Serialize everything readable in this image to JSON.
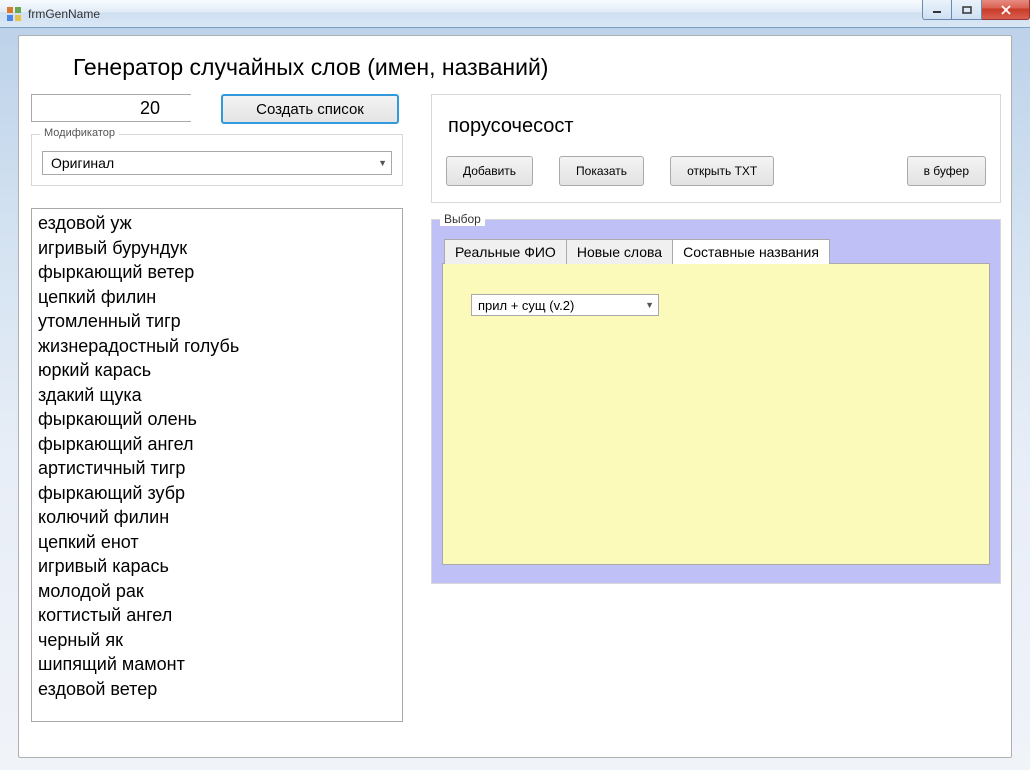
{
  "window": {
    "title": "frmGenName"
  },
  "header": {
    "title": "Генератор случайных слов (имен, названий)"
  },
  "controls": {
    "count_value": "20",
    "create_button": "Создать список",
    "modifier_group": "Модификатор",
    "modifier_value": "Оригинал"
  },
  "list_items": [
    "ездовой уж",
    "игривый бурундук",
    "фыркающий ветер",
    "цепкий филин",
    "утомленный тигр",
    "жизнерадостный голубь",
    "юркий карась",
    "здакий щука",
    "фыркающий олень",
    "фыркающий ангел",
    "артистичный тигр",
    "фыркающий зубр",
    "колючий филин",
    "цепкий енот",
    "игривый карась",
    "молодой рак",
    "когтистый ангел",
    "черный як",
    "шипящий мамонт",
    "ездовой ветер"
  ],
  "result": {
    "text": "порусочесост",
    "add_btn": "Добавить",
    "show_btn": "Показать",
    "open_txt_btn": "открыть TXT",
    "buffer_btn": "в буфер"
  },
  "choice": {
    "legend": "Выбор",
    "tabs": [
      "Реальные ФИО",
      "Новые слова",
      "Составные названия"
    ],
    "active_tab": 2,
    "combo_value": "прил + сущ (v.2)"
  }
}
